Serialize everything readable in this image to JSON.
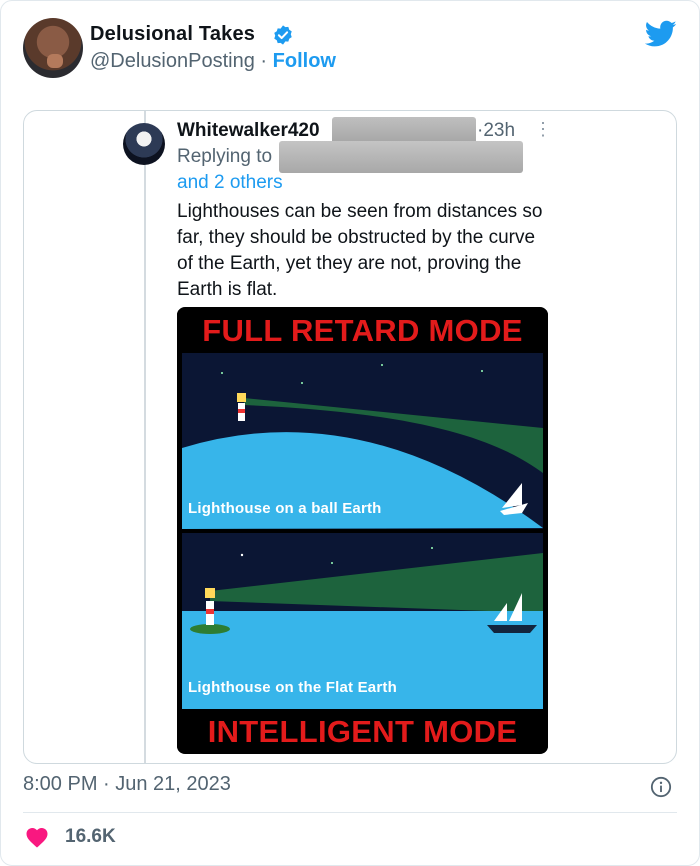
{
  "author": {
    "name": "Delusional Takes",
    "handle": "@DelusionPosting",
    "separator": "·",
    "follow_label": "Follow"
  },
  "quoted": {
    "name": "Whitewalker420",
    "time": "23h",
    "replying_label": "Replying to",
    "others_label": "and 2 others",
    "text": "Lighthouses can be seen from distances so far, they should be obstructed by the curve of the Earth, yet they are not, proving the Earth is flat.",
    "meme": {
      "top_banner": "FULL RETARD MODE",
      "caption_top": "Lighthouse on a ball Earth",
      "caption_bottom": "Lighthouse on the Flat Earth",
      "bottom_banner": "INTELLIGENT MODE"
    }
  },
  "footer": {
    "timestamp": "8:00 PM · Jun 21, 2023",
    "likes": "16.6K"
  },
  "colors": {
    "accent": "#1d9bf0",
    "like": "#f91880",
    "meme_red": "#e31b1b"
  },
  "icons": [
    "verified-badge-icon",
    "twitter-bird-icon",
    "more-icon",
    "info-icon",
    "heart-icon"
  ]
}
